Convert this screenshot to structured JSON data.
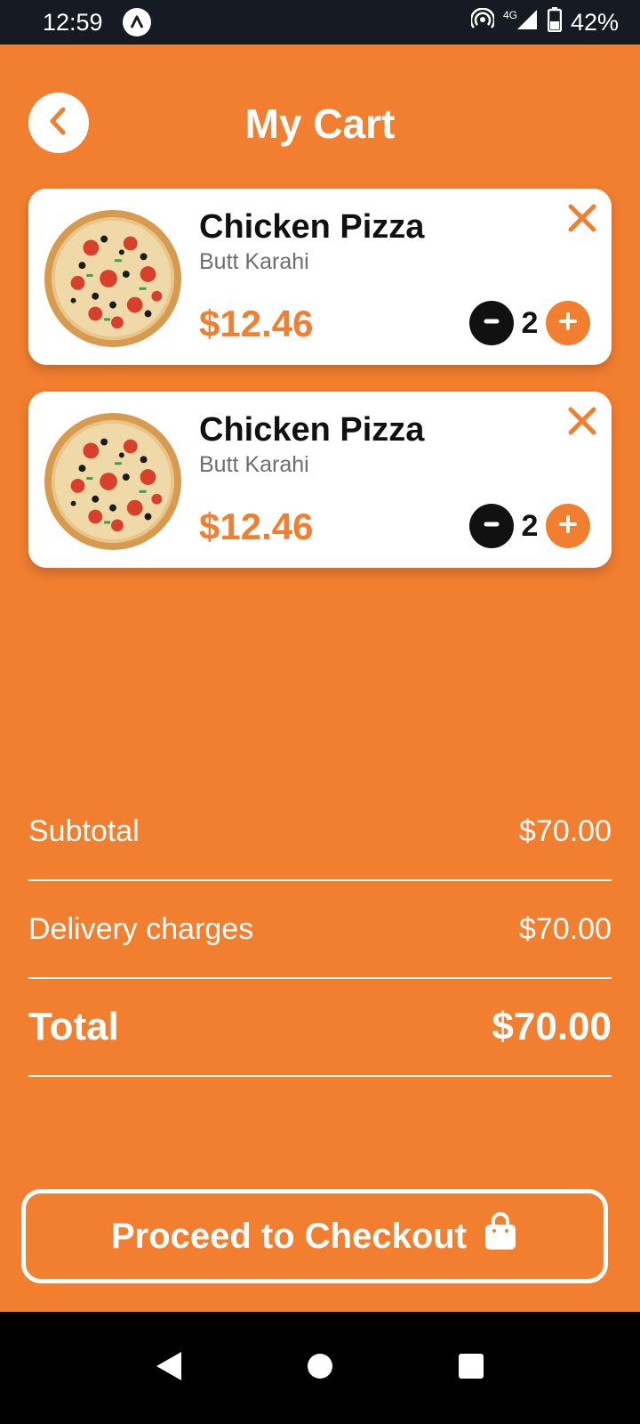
{
  "status_bar": {
    "time": "12:59",
    "network": "4G",
    "battery": "42%"
  },
  "header": {
    "title": "My Cart",
    "back_icon": "chevron-left-icon"
  },
  "cart": {
    "items": [
      {
        "name": "Chicken Pizza",
        "vendor": "Butt Karahi",
        "price": "$12.46",
        "quantity": "2"
      },
      {
        "name": "Chicken Pizza",
        "vendor": "Butt Karahi",
        "price": "$12.46",
        "quantity": "2"
      }
    ]
  },
  "summary": {
    "subtotal_label": "Subtotal",
    "subtotal_value": "$70.00",
    "delivery_label": "Delivery charges",
    "delivery_value": "$70.00",
    "total_label": "Total",
    "total_value": "$70.00"
  },
  "checkout": {
    "label": "Proceed to Checkout",
    "icon": "shopping-bag-icon"
  },
  "colors": {
    "accent": "#F27E30",
    "card": "#ffffff",
    "text_dark": "#111111",
    "text_muted": "#6d6d6d"
  }
}
